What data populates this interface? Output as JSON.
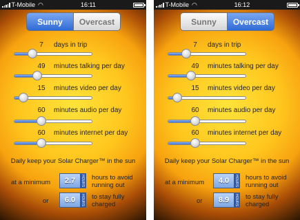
{
  "screens": [
    {
      "status": {
        "carrier": "T-Mobile",
        "time": "16:11"
      },
      "tabs": [
        {
          "label": "Sunny",
          "active": true
        },
        {
          "label": "Overcast",
          "active": false
        }
      ],
      "sliders": [
        {
          "value": "7",
          "label": "days in trip",
          "fraction": 0.24
        },
        {
          "value": "49",
          "label": "minutes talking per day",
          "fraction": 0.3
        },
        {
          "value": "15",
          "label": "minutes video per day",
          "fraction": 0.12
        },
        {
          "value": "60",
          "label": "minutes audio per day",
          "fraction": 0.35
        },
        {
          "value": "60",
          "label": "minutes internet per day",
          "fraction": 0.35
        }
      ],
      "daily_text": "Daily keep your Solar Charger™ in the sun",
      "minimum_label": "at a minimum",
      "minimum_value": "2.7",
      "minimum_unit": "HOURS",
      "minimum_desc": "hours to avoid running out",
      "or_label": "or",
      "full_value": "6.0",
      "full_unit": "HOURS",
      "full_desc": "to stay fully charged"
    },
    {
      "status": {
        "carrier": "T-Mobile",
        "time": "16:12"
      },
      "tabs": [
        {
          "label": "Sunny",
          "active": false
        },
        {
          "label": "Overcast",
          "active": true
        }
      ],
      "sliders": [
        {
          "value": "7",
          "label": "days in trip",
          "fraction": 0.24
        },
        {
          "value": "49",
          "label": "minutes talking per day",
          "fraction": 0.3
        },
        {
          "value": "15",
          "label": "minutes video per day",
          "fraction": 0.12
        },
        {
          "value": "60",
          "label": "minutes audio per day",
          "fraction": 0.35
        },
        {
          "value": "60",
          "label": "minutes internet per day",
          "fraction": 0.35
        }
      ],
      "daily_text": "Daily keep your Solar Charger™ in the sun",
      "minimum_label": "at a minimum",
      "minimum_value": "4.0",
      "minimum_unit": "HOURS",
      "minimum_desc": "hours to avoid running out",
      "or_label": "or",
      "full_value": "8.9",
      "full_unit": "HOURS",
      "full_desc": "to stay fully charged"
    }
  ]
}
